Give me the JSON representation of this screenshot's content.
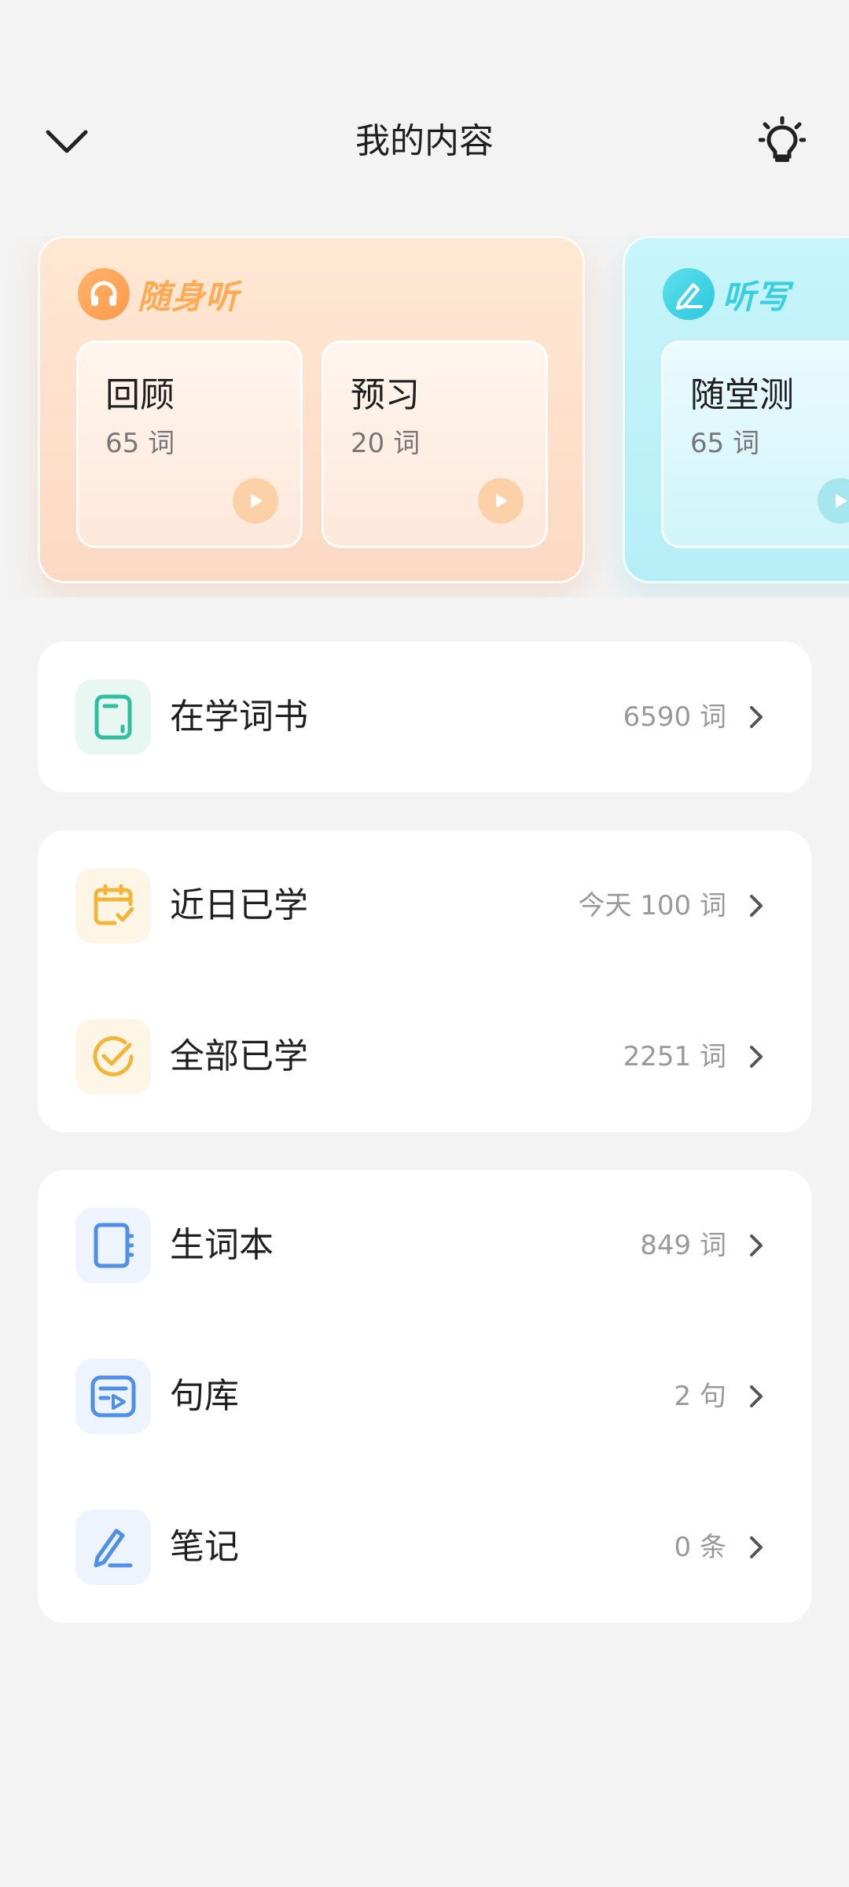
{
  "header": {
    "title": "我的内容"
  },
  "cards": {
    "listen": {
      "brand": "随身听",
      "items": [
        {
          "label": "回顾",
          "count": "65 词"
        },
        {
          "label": "预习",
          "count": "20 词"
        }
      ]
    },
    "dictation": {
      "brand": "听写",
      "items": [
        {
          "label": "随堂测",
          "count": "65 词"
        }
      ]
    }
  },
  "groups": {
    "book": [
      {
        "label": "在学词书",
        "value": "6590 词",
        "icon": "book-icon"
      }
    ],
    "learned": [
      {
        "label": "近日已学",
        "value": "今天 100 词",
        "icon": "calendar-check-icon"
      },
      {
        "label": "全部已学",
        "value": "2251 词",
        "icon": "check-circle-icon"
      }
    ],
    "collections": [
      {
        "label": "生词本",
        "value": "849 词",
        "icon": "notebook-icon"
      },
      {
        "label": "句库",
        "value": "2 句",
        "icon": "sentence-library-icon"
      },
      {
        "label": "笔记",
        "value": "0 条",
        "icon": "pen-icon"
      }
    ]
  },
  "colors": {
    "background": "#f3f3f3",
    "green_icon": "#2fbfa0",
    "yellow_icon": "#f2b53a",
    "blue_icon": "#4f8fe6",
    "listen_accent": "#ffaa55",
    "dictation_accent": "#38cfe2"
  }
}
